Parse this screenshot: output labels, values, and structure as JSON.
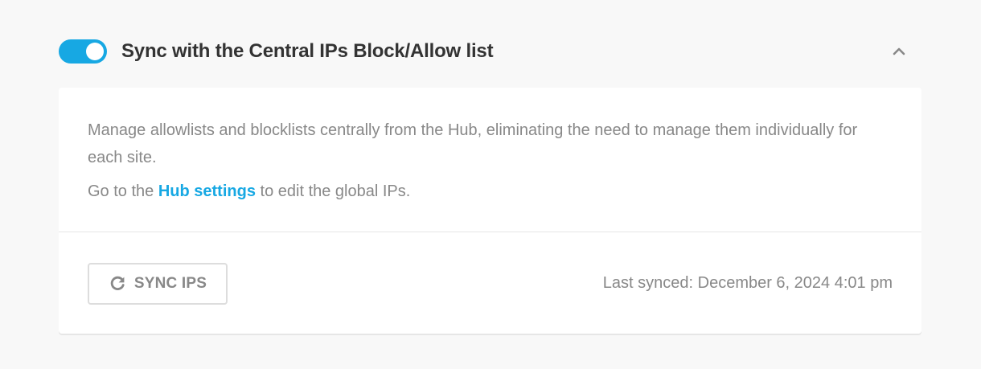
{
  "header": {
    "toggle_on": true,
    "title": "Sync with the Central IPs Block/Allow list",
    "collapse_icon": "chevron-up-icon"
  },
  "card": {
    "description": "Manage allowlists and blocklists centrally from the Hub, eliminating the need to manage them individually for each site.",
    "hub_prefix": "Go to the ",
    "hub_link": "Hub settings",
    "hub_suffix": " to edit the global IPs.",
    "sync_button_label": "SYNC IPS",
    "sync_icon": "refresh-icon",
    "last_synced": "Last synced: December 6, 2024 4:01 pm"
  },
  "colors": {
    "accent": "#17a8e3",
    "title_text": "#333333",
    "muted_text": "#888888",
    "background": "#f8f8f8",
    "card": "#ffffff"
  }
}
